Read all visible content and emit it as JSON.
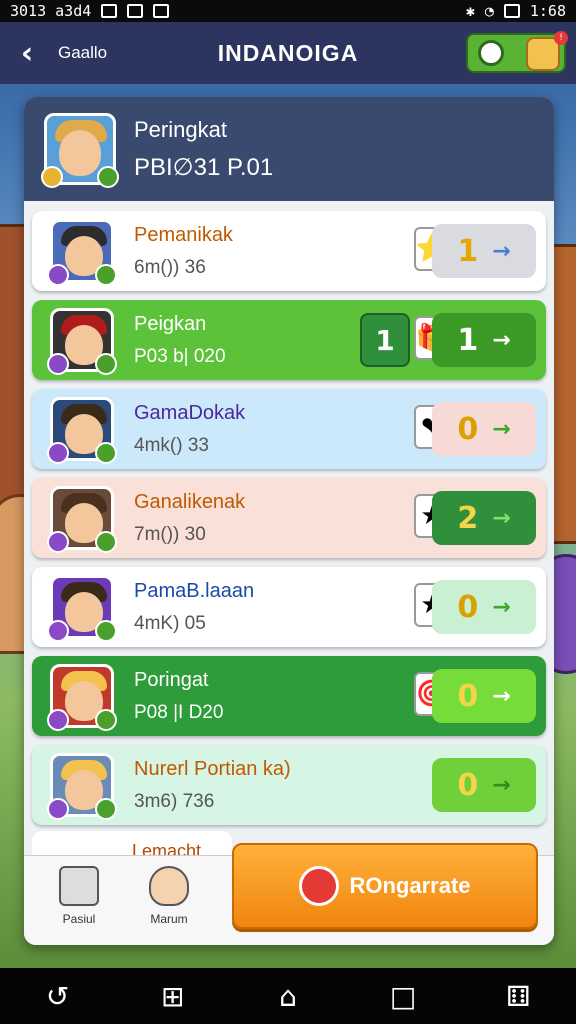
{
  "status_bar": {
    "left_text": "3013 a3d4",
    "right_text": "1:68"
  },
  "topbar": {
    "back_label": "Gaallo",
    "title": "INDANOIGA"
  },
  "header": {
    "title": "Peringkat",
    "subtitle": "PBI∅31 P.01"
  },
  "rows": [
    {
      "name": "Pemanikak",
      "score": "6m()) 36",
      "value": "1",
      "bg": "#ffffff",
      "name_color": "#c05a00",
      "ctrl_bg": "#d9dbe0",
      "ctrl_color": "#e0a800",
      "arrow_color": "#4a7bd6",
      "item": "⭐",
      "hair": "#2c2c2c",
      "shirt": "#4b6bb8"
    },
    {
      "name": "Peigkan",
      "score": "P03 b| 020",
      "value": "1",
      "rank": "1",
      "bg": "#5cc23a",
      "name_color": "#ffffff",
      "ctrl_bg": "#3b9a25",
      "ctrl_color": "#ffffff",
      "arrow_color": "#ffffff",
      "item": "🎁",
      "hair": "#b01c1c",
      "shirt": "#333"
    },
    {
      "name": "GamaDokak",
      "score": "4mk() 33",
      "value": "0",
      "bg": "#cbe9fb",
      "name_color": "#4a2a9a",
      "ctrl_bg": "#f7d9d5",
      "ctrl_color": "#d9a000",
      "arrow_color": "#3aa82a",
      "item": "❤",
      "hair": "#3a2a1a",
      "shirt": "#2a4a7a"
    },
    {
      "name": "Ganalikenak",
      "score": "7m()) 30",
      "value": "2",
      "bg": "#f9e0d8",
      "name_color": "#c05a00",
      "ctrl_bg": "#2f8f3a",
      "ctrl_color": "#f5d44a",
      "arrow_color": "#7fe06a",
      "item": "★",
      "hair": "#4a3020",
      "shirt": "#6a4a3a"
    },
    {
      "name": "PamaB.laaan",
      "score": "4mK) 05",
      "value": "0",
      "bg": "#ffffff",
      "name_color": "#1a4aa8",
      "ctrl_bg": "#c9f0d3",
      "ctrl_color": "#d9a000",
      "arrow_color": "#3aa82a",
      "item": "★",
      "hair": "#3a2a1a",
      "shirt": "#6a3ab8"
    },
    {
      "name": "Poringat",
      "score": "P08 |I D20",
      "value": "0",
      "bg": "#2e9c3a",
      "name_color": "#ffffff",
      "ctrl_bg": "#76dc3a",
      "ctrl_color": "#f5d44a",
      "arrow_color": "#ffffff",
      "item": "🎯",
      "hair": "#f2c14e",
      "shirt": "#c0392b"
    },
    {
      "name": "Nurerl Portian ka)",
      "score": "3m6) 736",
      "value": "0",
      "bg": "#d6f5e4",
      "name_color": "#c05a00",
      "ctrl_bg": "#6fd03a",
      "ctrl_color": "#f5d44a",
      "arrow_color": "#2f8f1a",
      "item": "",
      "hair": "#f2c14e",
      "shirt": "#6a8ab8"
    }
  ],
  "partial_row": {
    "name": "Lemacht"
  },
  "bottom_tabs": [
    {
      "label": "Pasiul"
    },
    {
      "label": "Marum"
    }
  ],
  "cta": {
    "label": "ROngarrate"
  }
}
